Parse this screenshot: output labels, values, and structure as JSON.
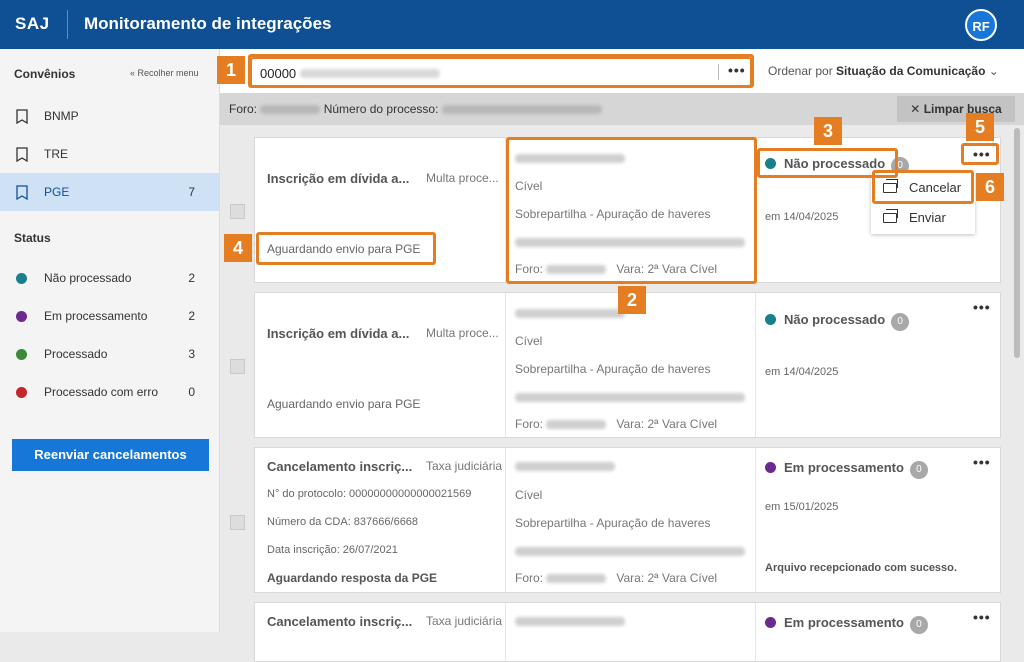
{
  "header": {
    "brand": "SAJ",
    "title": "Monitoramento de integrações",
    "avatar": "RF"
  },
  "sidebar": {
    "convenios_title": "Convênios",
    "collapse_label": "Recolher menu",
    "convenios": [
      {
        "label": "BNMP",
        "count": ""
      },
      {
        "label": "TRE",
        "count": ""
      },
      {
        "label": "PGE",
        "count": "7"
      }
    ],
    "status_title": "Status",
    "statuses": [
      {
        "label": "Não processado",
        "count": "2",
        "color": "#1a7f8c"
      },
      {
        "label": "Em processamento",
        "count": "2",
        "color": "#6b2a8f"
      },
      {
        "label": "Processado",
        "count": "3",
        "color": "#3a8a3a"
      },
      {
        "label": "Processado com erro",
        "count": "0",
        "color": "#c0262b"
      }
    ],
    "resend_button": "Reenviar cancelamentos"
  },
  "search": {
    "value": "00000",
    "more": "•••"
  },
  "sort": {
    "label": "Ordenar por",
    "value": "Situação da Comunicação"
  },
  "filter": {
    "foro_label": "Foro:",
    "processo_label": "Número do processo:",
    "clear_button": "Limpar busca"
  },
  "cards": [
    {
      "title": "Inscrição em dívida a...",
      "type": "Multa proce...",
      "lines": [],
      "wait": "Aguardando envio para PGE",
      "class": "Cível",
      "subject": "Sobrepartilha - Apuração de haveres",
      "foro_label": "Foro:",
      "vara": "Vara: 2ª Vara Cível",
      "status": "Não processado",
      "status_color": "#1a7f8c",
      "badge": "0",
      "date": "em 14/04/2025",
      "msg": ""
    },
    {
      "title": "Inscrição em dívida a...",
      "type": "Multa proce...",
      "lines": [],
      "wait": "Aguardando envio para PGE",
      "class": "Cível",
      "subject": "Sobrepartilha - Apuração de haveres",
      "foro_label": "Foro:",
      "vara": "Vara: 2ª Vara Cível",
      "status": "Não processado",
      "status_color": "#1a7f8c",
      "badge": "0",
      "date": "em 14/04/2025",
      "msg": ""
    },
    {
      "title": "Cancelamento inscriç...",
      "type": "Taxa judiciária",
      "lines": [
        "N° do protocolo: 00000000000000021569",
        "Número da CDA: 837666/6668",
        "Data inscrição: 26/07/2021"
      ],
      "wait": "Aguardando resposta da PGE",
      "class": "Cível",
      "subject": "Sobrepartilha - Apuração de haveres",
      "foro_label": "Foro:",
      "vara": "Vara: 2ª Vara Cível",
      "status": "Em processamento",
      "status_color": "#6b2a8f",
      "badge": "0",
      "date": "em 15/01/2025",
      "msg": "Arquivo recepcionado com sucesso."
    },
    {
      "title": "Cancelamento inscriç...",
      "type": "Taxa judiciária",
      "status": "Em processamento",
      "status_color": "#6b2a8f",
      "badge": "0"
    }
  ],
  "context_menu": {
    "items": [
      "Cancelar",
      "Enviar"
    ]
  },
  "callouts": [
    "1",
    "2",
    "3",
    "4",
    "5",
    "6"
  ]
}
